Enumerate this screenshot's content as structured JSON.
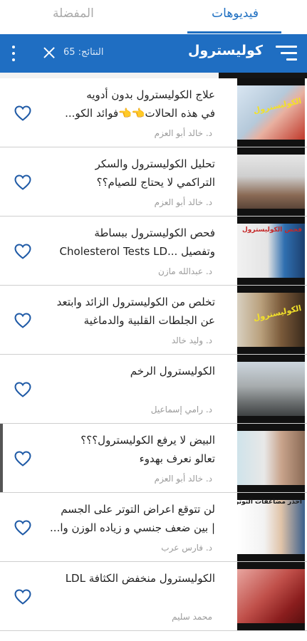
{
  "tabs": {
    "videos": "فيديوهات",
    "favorites": "المفضلة"
  },
  "toolbar": {
    "title": "كوليسترول",
    "results": "النتائج: 65"
  },
  "colors": {
    "accent": "#1f6ec2",
    "heart": "#1f5aa6"
  },
  "videos": [
    {
      "line1": "علاج الكوليسترول بدون أدويه",
      "line2": "في هذه الحالات👈👈فوائد الكو...",
      "author": "د. خالد أبو العزم",
      "thumb_text": "الكوليسترول"
    },
    {
      "line1": "تحليل الكوليسترول والسكر",
      "line2": "التراكمي لا يحتاج للصيام؟؟",
      "author": "د. خالد أبو العزم",
      "thumb_text": ""
    },
    {
      "line1": "فحص الكوليسترول ببساطة",
      "line2": "وتفصيل ...Cholesterol Tests LD",
      "author": "د. عبدالله مازن",
      "thumb_text": "فحص الكوليسترول"
    },
    {
      "line1": "تخلص من الكوليسترول الزائد وابتعد",
      "line2": "عن الجلطات القلبية والدماغية",
      "author": "د. وليد خالد",
      "thumb_text": "الكوليسترول"
    },
    {
      "line1": "الكوليسترول الرخم",
      "line2": "",
      "author": "د. رامي إسماعيل",
      "thumb_text": ""
    },
    {
      "line1": "البيض لا يرفع الكوليسترول؟؟؟",
      "line2": "تعالو نعرف بهدوء",
      "author": "د. خالد أبو العزم",
      "thumb_text": ""
    },
    {
      "line1": "لن تتوقع اعراض التوتر  على الجسم",
      "line2": "| بين ضعف جنسي و زياده الوزن وا...",
      "author": "د. فارس عرب",
      "thumb_text": "احذر مضاعفات التوتر"
    },
    {
      "line1": "الكوليسترول منخفض الكثافة LDL",
      "line2": "",
      "author": "محمد سليم",
      "thumb_text": ""
    }
  ]
}
